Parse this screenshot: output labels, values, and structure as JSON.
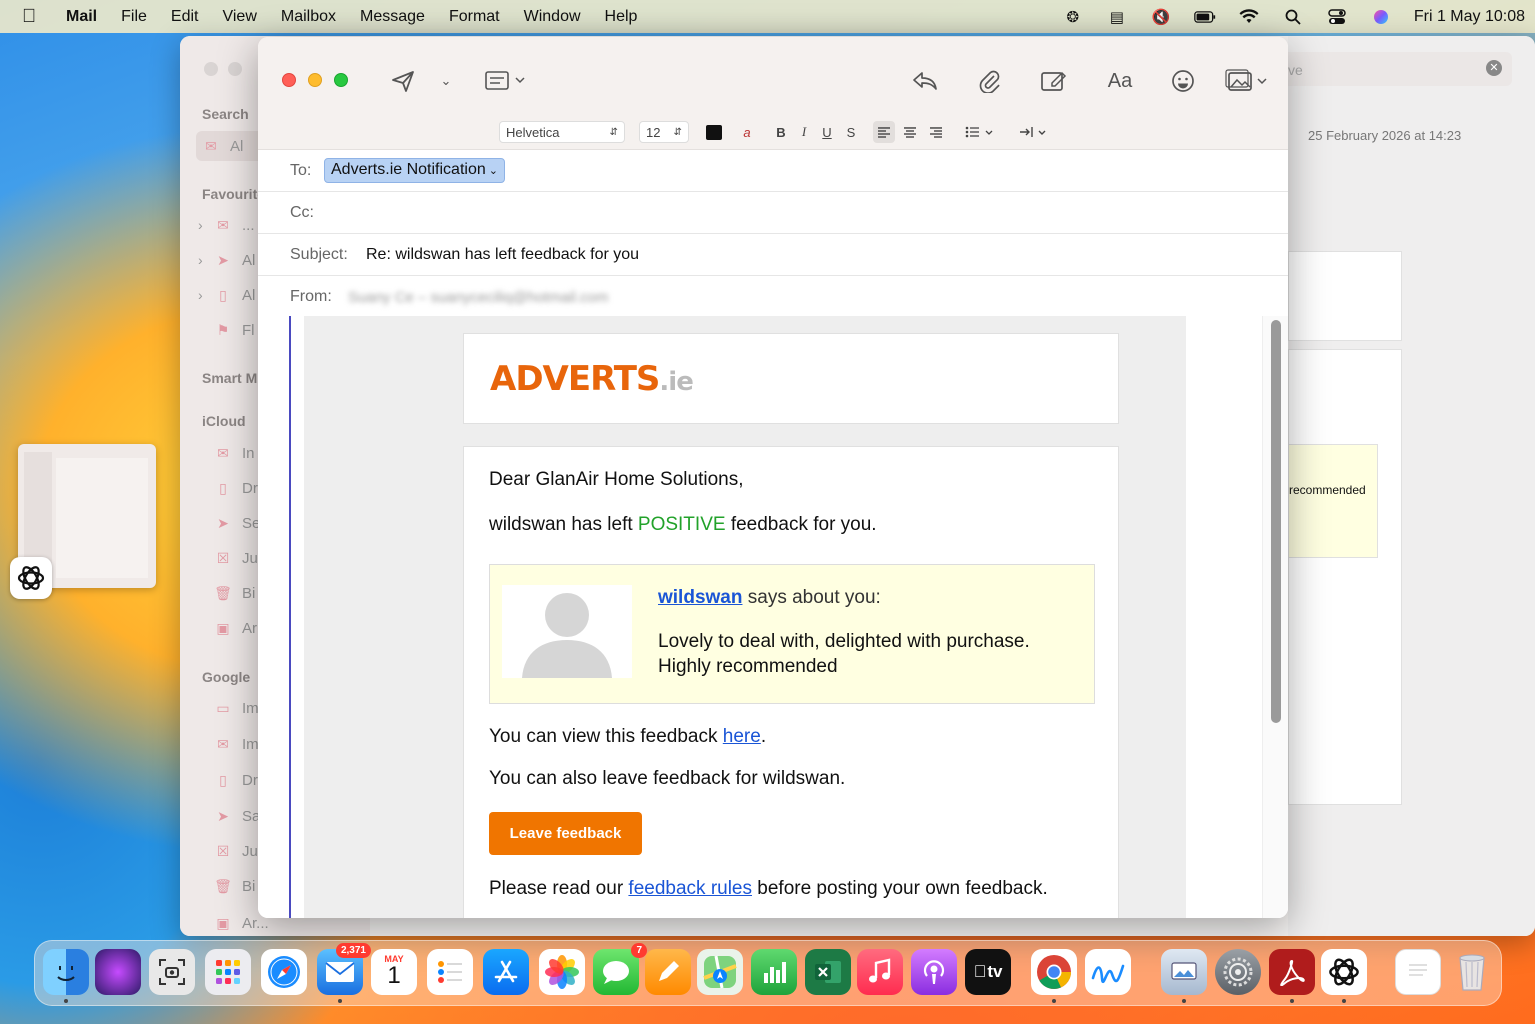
{
  "menubar": {
    "app_name": "Mail",
    "items": [
      "File",
      "Edit",
      "View",
      "Mailbox",
      "Message",
      "Format",
      "Window",
      "Help"
    ],
    "datetime": "Fri 1 May  10:08"
  },
  "background_window": {
    "search_label": "Search",
    "search_placeholder": "ve",
    "date": "25 February 2026 at 14:23",
    "sections": {
      "favourites": "Favourites",
      "smart": "Smart M",
      "icloud": "iCloud",
      "google": "Google"
    },
    "rows": [
      "Al",
      "...",
      "Al",
      "Al",
      "Fl",
      "In",
      "Dr",
      "Se",
      "Ju",
      "Bi",
      "Ar",
      "Im",
      "Im",
      "Dr",
      "Sa",
      "Ju",
      "Bi",
      "Ar..."
    ],
    "card_text": "recommended"
  },
  "compose": {
    "format_bar": {
      "font": "Helvetica",
      "size": "12",
      "bold": "B",
      "italic": "I",
      "underline": "U",
      "strike": "S"
    },
    "font_button": "Aa",
    "to_label": "To:",
    "to_value": "Adverts.ie Notification",
    "cc_label": "Cc:",
    "subject_label": "Subject:",
    "subject_value": "Re: wildswan has left feedback for you",
    "from_label": "From:",
    "from_value": "Suany Ce – suanyceciliq@hotmail.com"
  },
  "email": {
    "logo_main": "ADVERTS",
    "logo_suffix": ".ie",
    "greeting": "Dear GlanAir Home Solutions,",
    "line1_pre": "wildswan has left ",
    "line1_highlight": "POSITIVE",
    "line1_post": " feedback for you.",
    "reviewer": "wildswan",
    "says": " says about you:",
    "review_line1": "Lovely to deal with, delighted with purchase.",
    "review_line2": "Highly recommended",
    "view_pre": "You can view this feedback ",
    "view_link": "here",
    "view_post": ".",
    "leave_line": "You can also leave feedback for wildswan.",
    "button": "Leave feedback",
    "rules_pre": "Please read our ",
    "rules_link": "feedback rules",
    "rules_post": " before posting your own feedback."
  },
  "dock": {
    "mail_badge": "2,371",
    "calendar_month": "MAY",
    "calendar_day": "1",
    "messages_badge": "7",
    "tv_label": "tv"
  },
  "colors": {
    "accent_orange": "#f07500",
    "positive_green": "#22a22a",
    "link_blue": "#1a55d6",
    "feedback_bg": "#ffffe1"
  }
}
